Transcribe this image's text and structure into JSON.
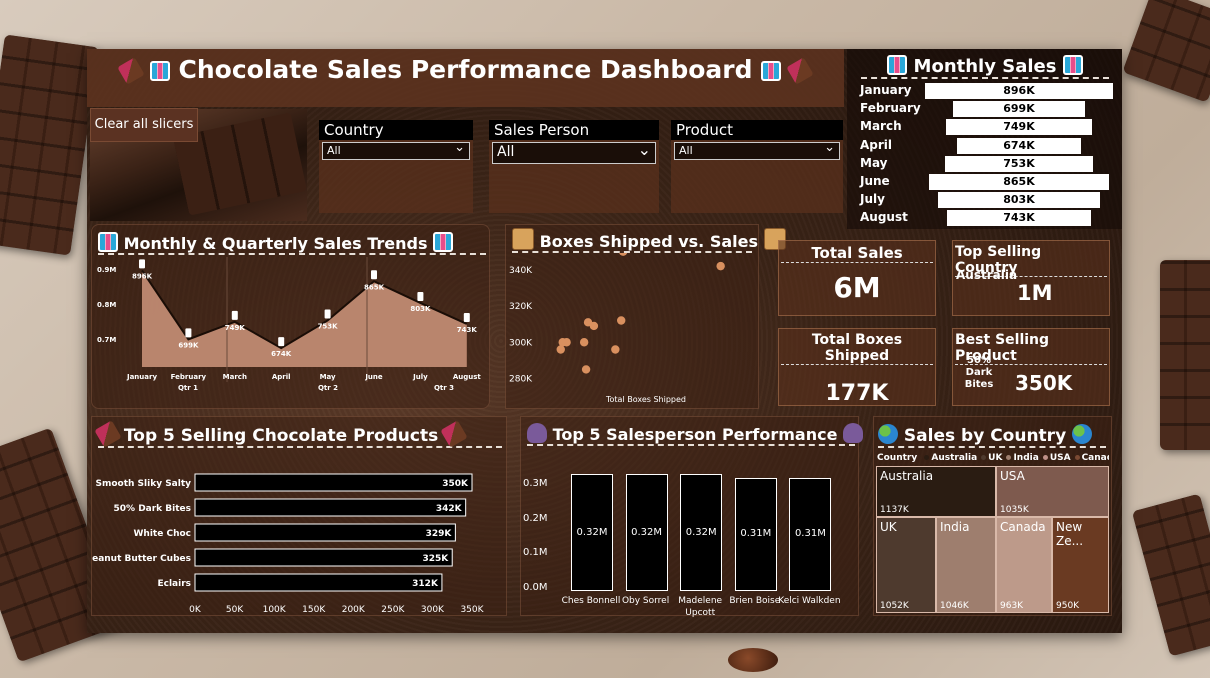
{
  "dashboard": {
    "title": "Chocolate Sales Performance Dashboard",
    "clear_slicers": "Clear all slicers"
  },
  "slicers": [
    {
      "label": "Country",
      "value": "All"
    },
    {
      "label": "Sales Person",
      "value": "All"
    },
    {
      "label": "Product",
      "value": "All"
    }
  ],
  "monthly_sales": {
    "title": "Monthly Sales",
    "rows": [
      {
        "month": "January",
        "value_label": "896K"
      },
      {
        "month": "February",
        "value_label": "699K"
      },
      {
        "month": "March",
        "value_label": "749K"
      },
      {
        "month": "April",
        "value_label": "674K"
      },
      {
        "month": "May",
        "value_label": "753K"
      },
      {
        "month": "June",
        "value_label": "865K"
      },
      {
        "month": "July",
        "value_label": "803K"
      },
      {
        "month": "August",
        "value_label": "743K"
      }
    ]
  },
  "trend": {
    "title": "Monthly & Quarterly Sales Trends",
    "y_ticks": [
      "0.9M",
      "0.8M",
      "0.7M"
    ],
    "quarters": [
      "Qtr 1",
      "Qtr 2",
      "Qtr 3"
    ]
  },
  "scatter": {
    "title": "Boxes Shipped vs. Sales",
    "x_label": "Total Boxes Shipped",
    "y_ticks": [
      "340K",
      "320K",
      "300K",
      "280K"
    ]
  },
  "kpis": {
    "total_sales": {
      "label": "Total Sales",
      "value": "6M"
    },
    "top_country": {
      "label": "Top Selling Country",
      "name": "Australia",
      "value": "1M"
    },
    "total_boxes": {
      "label": "Total Boxes Shipped",
      "value": "177K"
    },
    "best_product": {
      "label": "Best Selling Product",
      "name": "50% Dark Bites",
      "value": "350K"
    }
  },
  "top_products": {
    "title": "Top 5 Selling Chocolate Products",
    "x_ticks": [
      "0K",
      "50K",
      "100K",
      "150K",
      "200K",
      "250K",
      "300K",
      "350K"
    ]
  },
  "salesperson": {
    "title": "Top 5 Salesperson Performance",
    "y_ticks": [
      "0.3M",
      "0.2M",
      "0.1M",
      "0.0M"
    ]
  },
  "by_country": {
    "title": "Sales by Country",
    "legend_title": "Country",
    "legend": [
      "Australia",
      "UK",
      "India",
      "USA",
      "Canada"
    ],
    "legend_colors": [
      "#2a1c12",
      "#4e3a2e",
      "#9e7e6e",
      "#bd8f86",
      "#7a4a33"
    ]
  },
  "chart_data": [
    {
      "type": "area",
      "title": "Monthly & Quarterly Sales Trends",
      "categories": [
        "January",
        "February",
        "March",
        "April",
        "May",
        "June",
        "July",
        "August"
      ],
      "values": [
        896,
        699,
        749,
        674,
        753,
        865,
        803,
        743
      ],
      "labels": [
        "896K",
        "699K",
        "749K",
        "674K",
        "753K",
        "865K",
        "803K",
        "743K"
      ],
      "ylim": [
        620,
        920
      ],
      "unit": "K"
    },
    {
      "type": "scatter",
      "title": "Boxes Shipped vs. Sales",
      "xlabel": "Total Boxes Shipped",
      "points": [
        {
          "x": 0.05,
          "y": 296
        },
        {
          "x": 0.08,
          "y": 300
        },
        {
          "x": 0.06,
          "y": 300
        },
        {
          "x": 0.17,
          "y": 300
        },
        {
          "x": 0.19,
          "y": 311
        },
        {
          "x": 0.22,
          "y": 309
        },
        {
          "x": 0.18,
          "y": 285
        },
        {
          "x": 0.33,
          "y": 296
        },
        {
          "x": 0.36,
          "y": 312
        },
        {
          "x": 0.37,
          "y": 350
        },
        {
          "x": 0.87,
          "y": 342
        }
      ],
      "ylim": [
        272,
        352
      ]
    },
    {
      "type": "bar",
      "orientation": "horizontal",
      "title": "Top 5 Selling Chocolate Products",
      "categories": [
        "Smooth Sliky Salty",
        "50% Dark Bites",
        "White Choc",
        "Peanut Butter Cubes",
        "Eclairs"
      ],
      "values": [
        350,
        342,
        329,
        325,
        312
      ],
      "labels": [
        "350K",
        "342K",
        "329K",
        "325K",
        "312K"
      ],
      "xlim": [
        0,
        350
      ]
    },
    {
      "type": "bar",
      "title": "Top 5 Salesperson Performance",
      "categories": [
        "Ches Bonnell",
        "Oby Sorrel",
        "Madelene Upcott",
        "Brien Boise",
        "Kelci Walkden"
      ],
      "values": [
        0.32,
        0.32,
        0.32,
        0.31,
        0.31
      ],
      "labels": [
        "0.32M",
        "0.32M",
        "0.32M",
        "0.31M",
        "0.31M"
      ],
      "ylim": [
        0,
        0.3
      ]
    },
    {
      "type": "heatmap",
      "subtype": "treemap",
      "title": "Sales by Country",
      "categories": [
        "Australia",
        "USA",
        "UK",
        "India",
        "Canada",
        "New Ze..."
      ],
      "values": [
        1137,
        1035,
        1052,
        1046,
        963,
        950
      ],
      "labels": [
        "1137K",
        "1035K",
        "1052K",
        "1046K",
        "963K",
        "950K"
      ],
      "colors": [
        "#2a1c12",
        "#7e5a4e",
        "#4e3a2e",
        "#9e7e6e",
        "#bd9a8a",
        "#6a3a22"
      ]
    }
  ]
}
